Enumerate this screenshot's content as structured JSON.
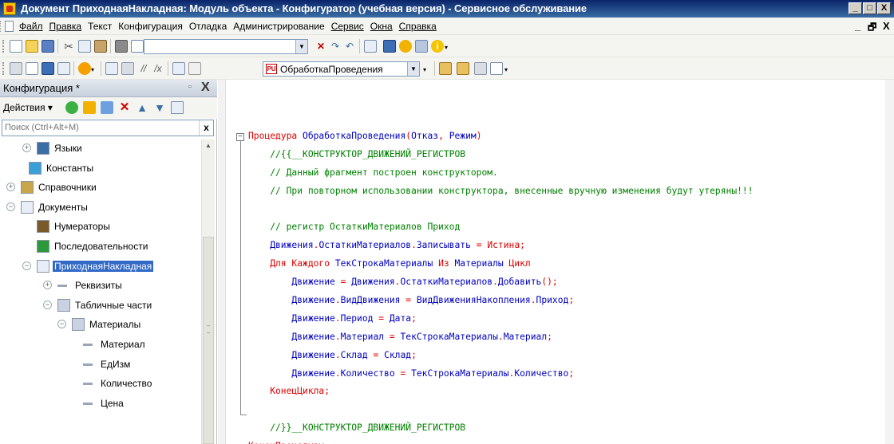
{
  "window": {
    "title": "Документ ПриходнаяНакладная: Модуль объекта - Конфигуратор (учебная версия) - Сервисное обслуживание",
    "minimize": "_",
    "maximize": "□",
    "close": "X"
  },
  "menubar": {
    "items": [
      {
        "label": "Файл",
        "underline": true
      },
      {
        "label": "Правка",
        "underline": true
      },
      {
        "label": "Текст",
        "underline": false
      },
      {
        "label": "Конфигурация",
        "underline": false
      },
      {
        "label": "Отладка",
        "underline": false
      },
      {
        "label": "Администрирование",
        "underline": false
      },
      {
        "label": "Сервис",
        "underline": true
      },
      {
        "label": "Окна",
        "underline": true
      },
      {
        "label": "Справка",
        "underline": true
      }
    ],
    "mdi_minimize": "_",
    "mdi_restore": "🗗",
    "mdi_close": "X"
  },
  "toolbar": {
    "search_value": "",
    "procedure_combo": "ОбработкаПроведения",
    "procedure_icon_text": "PU"
  },
  "panel": {
    "title": "Конфигурация *",
    "pin": "▫",
    "close": "X",
    "actions_label": "Действия ▾",
    "search_placeholder": "Поиск (Ctrl+Alt+M)",
    "search_clear": "x"
  },
  "tree": [
    {
      "label": "Языки",
      "expander": "+",
      "icon": "languages-icon"
    },
    {
      "label": "Константы",
      "expander": "",
      "icon": "constants-icon"
    },
    {
      "label": "Справочники",
      "expander": "+",
      "icon": "catalogs-icon"
    },
    {
      "label": "Документы",
      "expander": "−",
      "icon": "documents-icon"
    },
    {
      "label": "Нумераторы",
      "expander": "",
      "icon": "numerators-icon"
    },
    {
      "label": "Последовательности",
      "expander": "",
      "icon": "sequences-icon"
    },
    {
      "label": "ПриходнаяНакладная",
      "expander": "−",
      "icon": "document-icon",
      "selected": true
    },
    {
      "label": "Реквизиты",
      "expander": "+",
      "icon": "attribute-icon"
    },
    {
      "label": "Табличные части",
      "expander": "−",
      "icon": "table-icon"
    },
    {
      "label": "Материалы",
      "expander": "−",
      "icon": "table-icon"
    },
    {
      "label": "Материал",
      "expander": "",
      "icon": "attribute-icon"
    },
    {
      "label": "ЕдИзм",
      "expander": "",
      "icon": "attribute-icon"
    },
    {
      "label": "Количество",
      "expander": "",
      "icon": "attribute-icon"
    },
    {
      "label": "Цена",
      "expander": "",
      "icon": "attribute-icon"
    }
  ],
  "code": [
    [
      {
        "t": "Процедура",
        "c": "kw"
      },
      {
        "t": " ОбработкаПроведения",
        "c": "id"
      },
      {
        "t": "(",
        "c": "kw"
      },
      {
        "t": "Отказ",
        "c": "id"
      },
      {
        "t": ", ",
        "c": "kw"
      },
      {
        "t": "Режим",
        "c": "id"
      },
      {
        "t": ")",
        "c": "kw"
      }
    ],
    [
      {
        "t": "    //{{__КОНСТРУКТОР_ДВИЖЕНИЙ_РЕГИСТРОВ",
        "c": "cm"
      }
    ],
    [
      {
        "t": "    // Данный фрагмент построен конструктором.",
        "c": "cm"
      }
    ],
    [
      {
        "t": "    // При повторном использовании конструктора, внесенные вручную изменения будут утеряны!!!",
        "c": "cm"
      }
    ],
    [
      {
        "t": "",
        "c": "id"
      }
    ],
    [
      {
        "t": "    // регистр ОстаткиМатериалов Приход",
        "c": "cm"
      }
    ],
    [
      {
        "t": "    Движения",
        "c": "id"
      },
      {
        "t": ".",
        "c": "kw"
      },
      {
        "t": "ОстаткиМатериалов",
        "c": "id"
      },
      {
        "t": ".",
        "c": "kw"
      },
      {
        "t": "Записывать ",
        "c": "id"
      },
      {
        "t": "= ",
        "c": "kw"
      },
      {
        "t": "Истина",
        "c": "kw"
      },
      {
        "t": ";",
        "c": "kw"
      }
    ],
    [
      {
        "t": "    Для Каждого ",
        "c": "kw"
      },
      {
        "t": "ТекСтрокаМатериалы ",
        "c": "id"
      },
      {
        "t": "Из ",
        "c": "kw"
      },
      {
        "t": "Материалы ",
        "c": "id"
      },
      {
        "t": "Цикл",
        "c": "kw"
      }
    ],
    [
      {
        "t": "        Движение ",
        "c": "id"
      },
      {
        "t": "= ",
        "c": "kw"
      },
      {
        "t": "Движения",
        "c": "id"
      },
      {
        "t": ".",
        "c": "kw"
      },
      {
        "t": "ОстаткиМатериалов",
        "c": "id"
      },
      {
        "t": ".",
        "c": "kw"
      },
      {
        "t": "Добавить",
        "c": "id"
      },
      {
        "t": "();",
        "c": "kw"
      }
    ],
    [
      {
        "t": "        Движение",
        "c": "id"
      },
      {
        "t": ".",
        "c": "kw"
      },
      {
        "t": "ВидДвижения ",
        "c": "id"
      },
      {
        "t": "= ",
        "c": "kw"
      },
      {
        "t": "ВидДвиженияНакопления",
        "c": "id"
      },
      {
        "t": ".",
        "c": "kw"
      },
      {
        "t": "Приход",
        "c": "id"
      },
      {
        "t": ";",
        "c": "kw"
      }
    ],
    [
      {
        "t": "        Движение",
        "c": "id"
      },
      {
        "t": ".",
        "c": "kw"
      },
      {
        "t": "Период ",
        "c": "id"
      },
      {
        "t": "= ",
        "c": "kw"
      },
      {
        "t": "Дата",
        "c": "id"
      },
      {
        "t": ";",
        "c": "kw"
      }
    ],
    [
      {
        "t": "        Движение",
        "c": "id"
      },
      {
        "t": ".",
        "c": "kw"
      },
      {
        "t": "Материал ",
        "c": "id"
      },
      {
        "t": "= ",
        "c": "kw"
      },
      {
        "t": "ТекСтрокаМатериалы",
        "c": "id"
      },
      {
        "t": ".",
        "c": "kw"
      },
      {
        "t": "Материал",
        "c": "id"
      },
      {
        "t": ";",
        "c": "kw"
      }
    ],
    [
      {
        "t": "        Движение",
        "c": "id"
      },
      {
        "t": ".",
        "c": "kw"
      },
      {
        "t": "Склад ",
        "c": "id"
      },
      {
        "t": "= ",
        "c": "kw"
      },
      {
        "t": "Склад",
        "c": "id"
      },
      {
        "t": ";",
        "c": "kw"
      }
    ],
    [
      {
        "t": "        Движение",
        "c": "id"
      },
      {
        "t": ".",
        "c": "kw"
      },
      {
        "t": "Количество ",
        "c": "id"
      },
      {
        "t": "= ",
        "c": "kw"
      },
      {
        "t": "ТекСтрокаМатериалы",
        "c": "id"
      },
      {
        "t": ".",
        "c": "kw"
      },
      {
        "t": "Количество",
        "c": "id"
      },
      {
        "t": ";",
        "c": "kw"
      }
    ],
    [
      {
        "t": "    КонецЦикла",
        "c": "kw"
      },
      {
        "t": ";",
        "c": "kw"
      }
    ],
    [
      {
        "t": "",
        "c": "id"
      }
    ],
    [
      {
        "t": "    //}}__КОНСТРУКТОР_ДВИЖЕНИЙ_РЕГИСТРОВ",
        "c": "cm"
      }
    ],
    [
      {
        "t": "КонецПроцедуры",
        "c": "kw"
      }
    ]
  ],
  "colors": {
    "keyword": "#e00000",
    "identifier": "#0000c0",
    "comment": "#008000",
    "selection": "#3169c6"
  }
}
